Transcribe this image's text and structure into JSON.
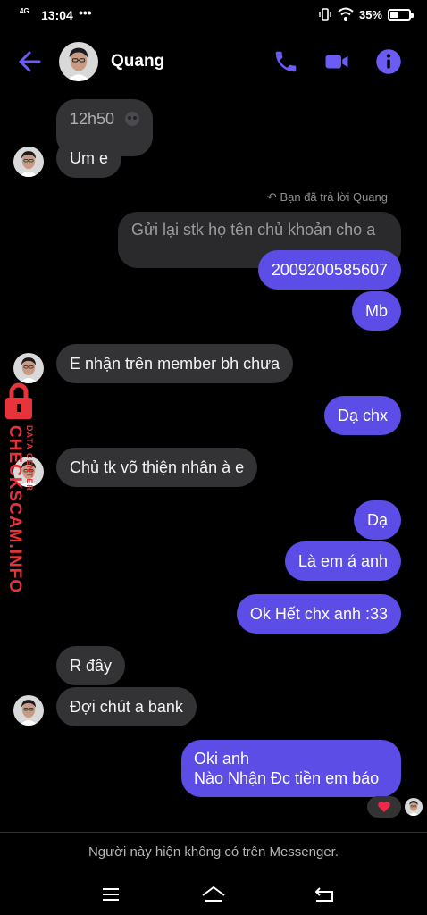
{
  "status_bar": {
    "network": "4G",
    "time": "13:04",
    "dots": "•••",
    "battery_percent": "35%",
    "battery_level": 0.35
  },
  "header": {
    "contact_name": "Quang",
    "icons": [
      "back-arrow-icon",
      "phone-icon",
      "video-icon",
      "info-icon"
    ],
    "accent_color": "#6c5cf6"
  },
  "messages": {
    "m1": "12h50",
    "m2": "Um e",
    "reply_note": "Bạn đã trả lời Quang",
    "quoted": "Gửi lại stk họ tên chủ khoản cho a",
    "m3": "2009200585607",
    "m4": "Mb",
    "m5": "E nhận trên member bh chưa",
    "m6": "Dạ chx",
    "m7": "Chủ tk võ thiện nhân à e",
    "m8": "Dạ",
    "m9": "Là em á anh",
    "m10": "Ok Hết chx anh :33",
    "m11": "R đây",
    "m12": "Đợi chút a bank",
    "m13_line1": "Oki anh",
    "m13_line2": "Nào Nhận Đc tiền em báo",
    "reaction": "heart-icon"
  },
  "footer": {
    "notice": "Người này hiện không có trên Messenger."
  },
  "watermark": {
    "main": "CHECKSCAM.INFO",
    "sub": "DATA CENTER"
  },
  "colors": {
    "outgoing_bubble": "#5b4de6",
    "incoming_bubble": "#333336",
    "background": "#000000"
  }
}
